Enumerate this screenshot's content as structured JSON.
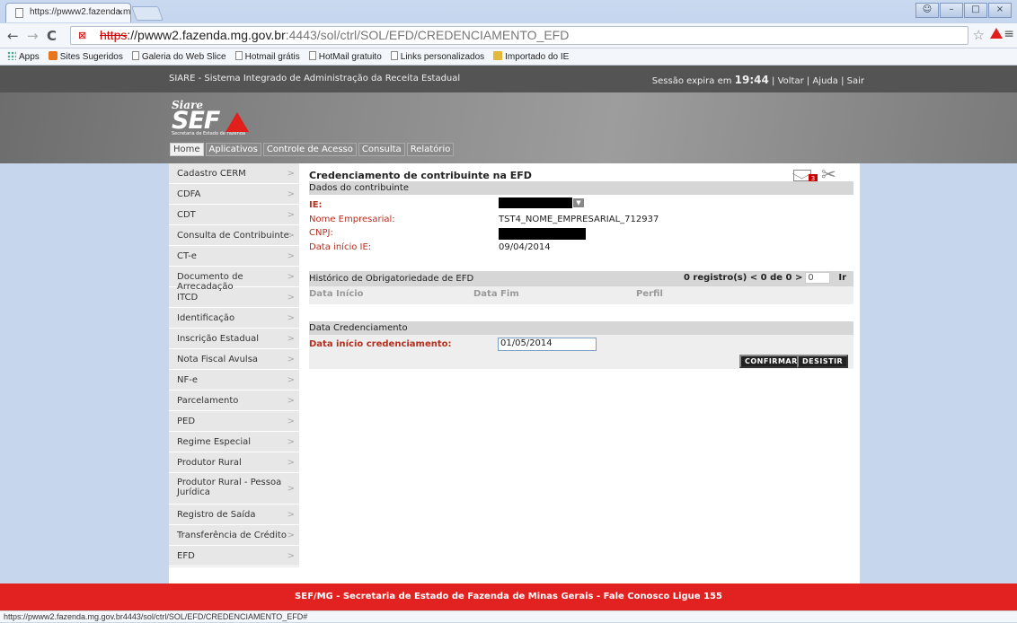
{
  "browser": {
    "tab_title": "https://pwww2.fazenda.m",
    "url_scheme": "https",
    "url_host": "://pwww2.fazenda.mg.gov.br",
    "url_rest": ":4443/sol/ctrl/SOL/EFD/CREDENCIAMENTO_EFD",
    "bookmarks": [
      "Apps",
      "Sites Sugeridos",
      "Galeria do Web Slice",
      "Hotmail grátis",
      "HotMail gratuito",
      "Links personalizados",
      "Importado do IE"
    ],
    "status_url": "https://pwww2.fazenda.mg.gov.br4443/sol/ctrl/SOL/EFD/CREDENCIAMENTO_EFD#"
  },
  "siare": {
    "top_title": "SIARE - Sistema Integrado de Administração da Receita Estadual",
    "session_label": "Sessão expira em",
    "session_time": "19:44",
    "voltar": "Voltar",
    "ajuda": "Ajuda",
    "sair": "Sair",
    "logo_small": "Siare",
    "logo_big": "SEF",
    "logo_sub": "Secretaria de Estado de Fazenda",
    "tabs": [
      "Home",
      "Aplicativos",
      "Controle de Acesso",
      "Consulta",
      "Relatório"
    ]
  },
  "sidebar": {
    "items": [
      "Cadastro CERM",
      "CDFA",
      "CDT",
      "Consulta de Contribuinte",
      "CT-e",
      "Documento de Arrecadação",
      "ITCD",
      "Identificação",
      "Inscrição Estadual",
      "Nota Fiscal Avulsa",
      "NF-e",
      "Parcelamento",
      "PED",
      "Regime Especial",
      "Produtor Rural",
      "Produtor Rural - Pessoa Jurídica",
      "Registro de Saída",
      "Transferência de Crédito",
      "EFD"
    ]
  },
  "main": {
    "page_title": "Credenciamento de contribuinte na EFD",
    "mail_count": "3",
    "section_contribuinte": "Dados do contribuinte",
    "ie_label": "IE:",
    "nome_label": "Nome Empresarial:",
    "nome_value": "TST4_NOME_EMPRESARIAL_712937",
    "cnpj_label": "CNPJ:",
    "data_ie_label": "Data início IE:",
    "data_ie_value": "09/04/2014",
    "section_historico": "Histórico de Obrigatoriedade de EFD",
    "pag_text": "0 registro(s) < 0 de 0 >",
    "pag_input": "0",
    "pag_go": "Ir",
    "col_inicio": "Data Início",
    "col_fim": "Data Fim",
    "col_perfil": "Perfil",
    "section_cred": "Data Credenciamento",
    "cred_label": "Data início credenciamento:",
    "cred_value": "01/05/2014",
    "btn_confirmar": "CONFIRMAR",
    "btn_desistir": "DESISTIR"
  },
  "footer": {
    "text": "SEF/MG - Secretaria de Estado de Fazenda de Minas Gerais - Fale Conosco Ligue 155"
  },
  "colors": {
    "footer_red": "#e12221",
    "label_red": "#b52f1f",
    "topbar_gray": "#545454"
  }
}
